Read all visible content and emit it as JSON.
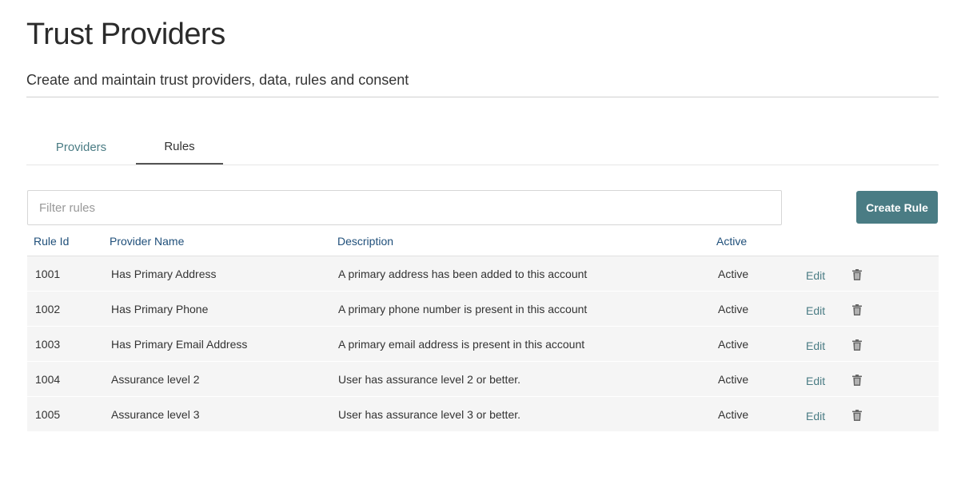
{
  "header": {
    "title": "Trust Providers",
    "subtitle": "Create and maintain trust providers, data, rules and consent"
  },
  "tabs": [
    {
      "label": "Providers",
      "active": false
    },
    {
      "label": "Rules",
      "active": true
    }
  ],
  "filter": {
    "placeholder": "Filter rules",
    "value": ""
  },
  "create_button": {
    "label": "Create Rule"
  },
  "table": {
    "columns": [
      "Rule Id",
      "Provider Name",
      "Description",
      "Active"
    ],
    "rows": [
      {
        "id": "1001",
        "name": "Has Primary Address",
        "description": "A primary address has been added to this account",
        "active": "Active",
        "edit": "Edit"
      },
      {
        "id": "1002",
        "name": "Has Primary Phone",
        "description": "A primary phone number is present in this account",
        "active": "Active",
        "edit": "Edit"
      },
      {
        "id": "1003",
        "name": "Has Primary Email Address",
        "description": "A primary email address is present in this account",
        "active": "Active",
        "edit": "Edit"
      },
      {
        "id": "1004",
        "name": "Assurance level 2",
        "description": "User has assurance level 2 or better.",
        "active": "Active",
        "edit": "Edit"
      },
      {
        "id": "1005",
        "name": "Assurance level 3",
        "description": "User has assurance level 3 or better.",
        "active": "Active",
        "edit": "Edit"
      }
    ]
  },
  "icons": {
    "delete": "trash-icon"
  },
  "colors": {
    "accent": "#4a7c84",
    "header_text": "#1f4f7a",
    "row_bg": "#f5f5f5"
  }
}
